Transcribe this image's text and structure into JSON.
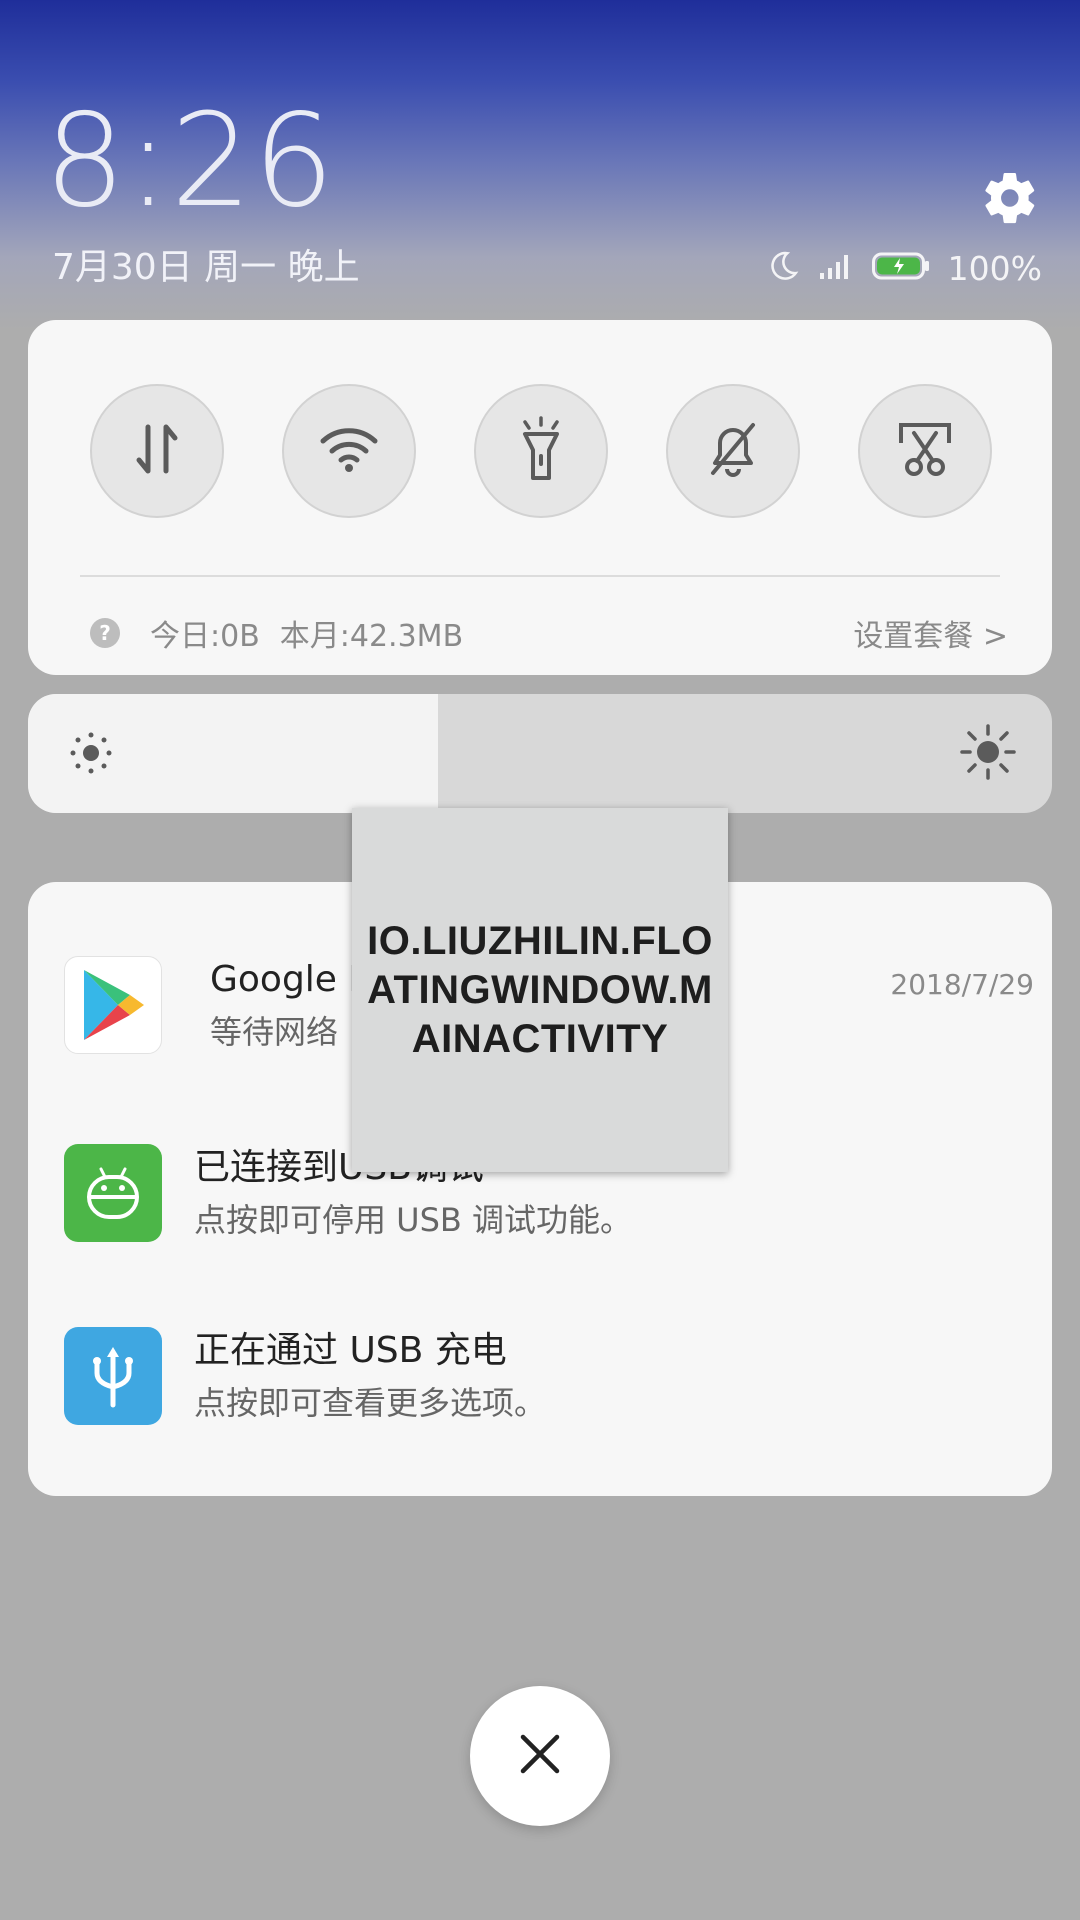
{
  "lockscreen": {
    "time": "8:26",
    "date": "7月30日 周一 晚上"
  },
  "status_bar": {
    "battery_percent": "100%",
    "icons": [
      "moon-icon",
      "signal-icon",
      "battery-charging-icon"
    ]
  },
  "quick_settings": {
    "toggles": [
      {
        "name": "mobile-data-icon"
      },
      {
        "name": "wifi-icon"
      },
      {
        "name": "flashlight-icon"
      },
      {
        "name": "mute-bell-icon"
      },
      {
        "name": "screenshot-scissors-icon"
      }
    ],
    "data_usage": {
      "today": "今日:0B",
      "month": "本月:42.3MB",
      "plan_link": "设置套餐 >"
    }
  },
  "brightness": {
    "level": 0.4
  },
  "notifications": [
    {
      "app_icon": "google-play-icon",
      "title": "Google P",
      "subtitle": "等待网络",
      "time": "2018/7/29"
    },
    {
      "app_icon": "android-debug-icon",
      "title": "已连接到USB调试",
      "subtitle": "点按即可停用 USB 调试功能。",
      "time": ""
    },
    {
      "app_icon": "usb-icon",
      "title": "正在通过  USB  充电",
      "subtitle": "点按即可查看更多选项。",
      "time": ""
    }
  ],
  "floating_window": {
    "text": "IO.LIUZHILIN.FLOATINGWINDOW.MAINACTIVITY"
  },
  "colors": {
    "accent_green": "#4cb648",
    "usb_blue": "#3fa7e1",
    "header_blue": "#1f2e9a"
  }
}
